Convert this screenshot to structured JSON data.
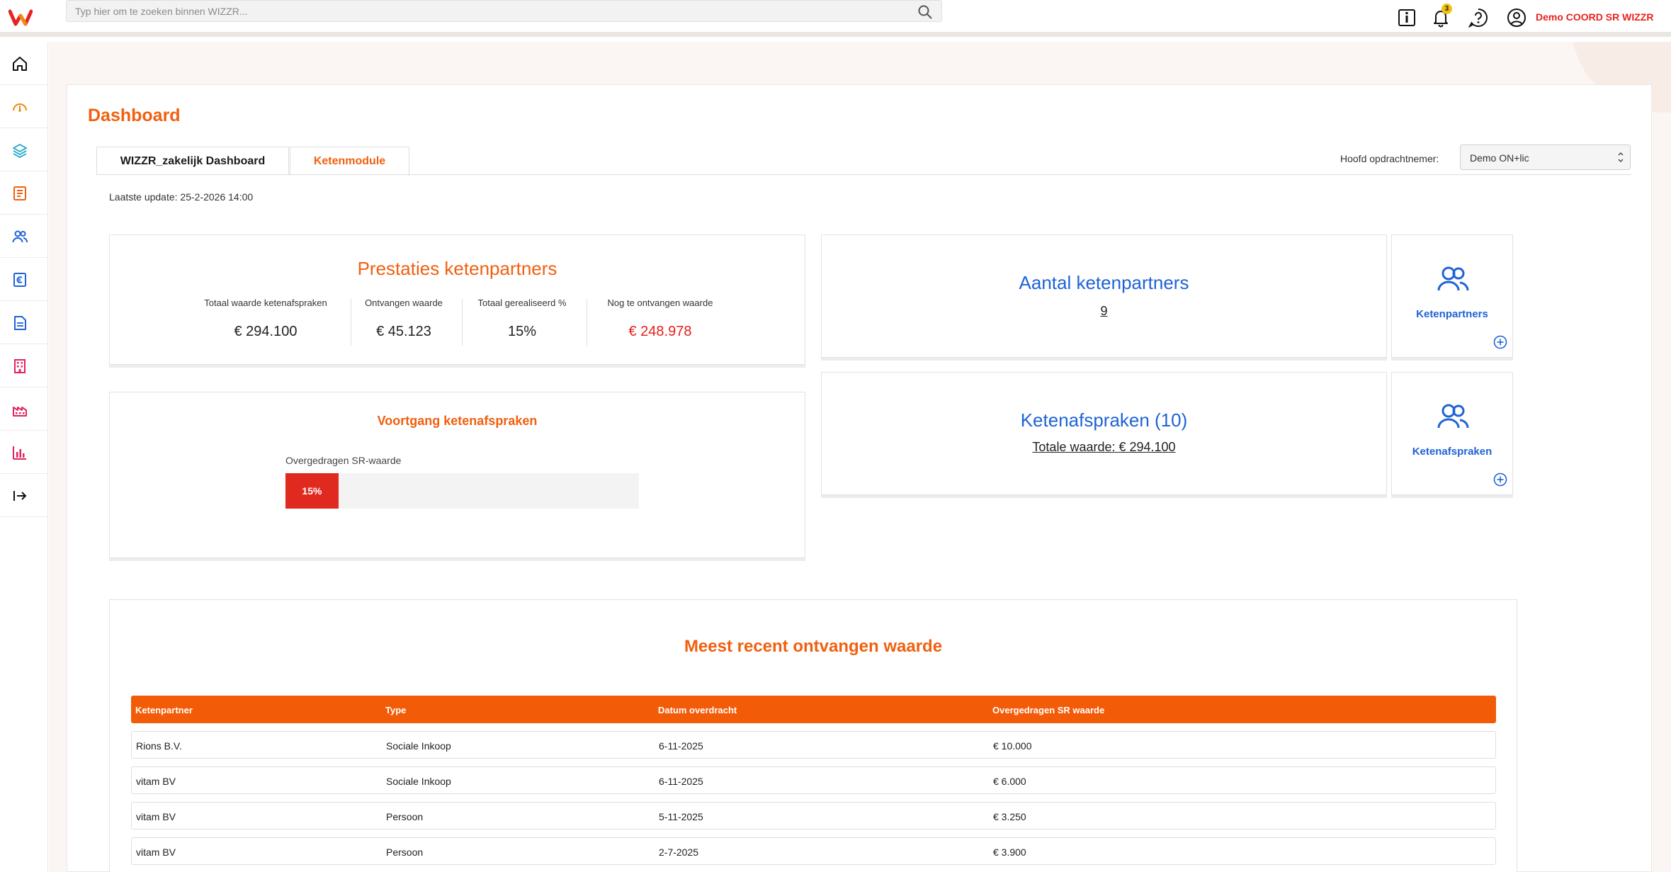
{
  "search": {
    "placeholder": "Typ hier om te zoeken binnen WIZZR..."
  },
  "header": {
    "notification_count": "3",
    "user_name": "Demo COORD SR WIZZR"
  },
  "sidebar": {
    "items": [
      {
        "icon": "home-icon"
      },
      {
        "icon": "gauge-icon"
      },
      {
        "icon": "layers-icon"
      },
      {
        "icon": "checklist-icon"
      },
      {
        "icon": "users-icon"
      },
      {
        "icon": "euro-document-icon"
      },
      {
        "icon": "document-icon"
      },
      {
        "icon": "building-icon"
      },
      {
        "icon": "factory-icon"
      },
      {
        "icon": "bar-chart-icon"
      },
      {
        "icon": "logout-icon"
      }
    ]
  },
  "page": {
    "title": "Dashboard",
    "tabs": [
      "WIZZR_zakelijk Dashboard",
      "Ketenmodule"
    ],
    "active_tab": "Ketenmodule",
    "contractor_label": "Hoofd opdrachtnemer:",
    "contractor_value": "Demo ON+lic",
    "last_update": "Laatste update: 25-2-2026 14:00"
  },
  "performance": {
    "title": "Prestaties ketenpartners",
    "kpis": [
      {
        "label": "Totaal waarde ketenafspraken",
        "value": "€ 294.100"
      },
      {
        "label": "Ontvangen waarde",
        "value": "€ 45.123"
      },
      {
        "label": "Totaal gerealiseerd %",
        "value": "15%"
      },
      {
        "label": "Nog te ontvangen waarde",
        "value": "€ 248.978"
      }
    ]
  },
  "progress": {
    "title": "Voortgang ketenafspraken",
    "label": "Overgedragen SR-waarde",
    "percent_label": "15%",
    "fraction": 0.15
  },
  "partners": {
    "title": "Aantal ketenpartners",
    "count": "9"
  },
  "agreements": {
    "title": "Ketenafspraken (10)",
    "total": "Totale waarde: € 294.100"
  },
  "shortcuts": {
    "partners_label": "Ketenpartners",
    "agreements_label": "Ketenafspraken"
  },
  "recent": {
    "title": "Meest recent ontvangen waarde",
    "columns": [
      "Ketenpartner",
      "Type",
      "Datum overdracht",
      "Overgedragen SR waarde"
    ],
    "rows": [
      [
        "Rions B.V.",
        "Sociale Inkoop",
        "6-11-2025",
        "€ 10.000"
      ],
      [
        "vitam BV",
        "Sociale Inkoop",
        "6-11-2025",
        "€ 6.000"
      ],
      [
        "vitam BV",
        "Persoon",
        "5-11-2025",
        "€ 3.250"
      ],
      [
        "vitam BV",
        "Persoon",
        "2-7-2025",
        "€ 3.900"
      ]
    ]
  },
  "colors": {
    "accent": "#f06010",
    "link_blue": "#1e63d6",
    "alert_red": "#e3201b"
  }
}
